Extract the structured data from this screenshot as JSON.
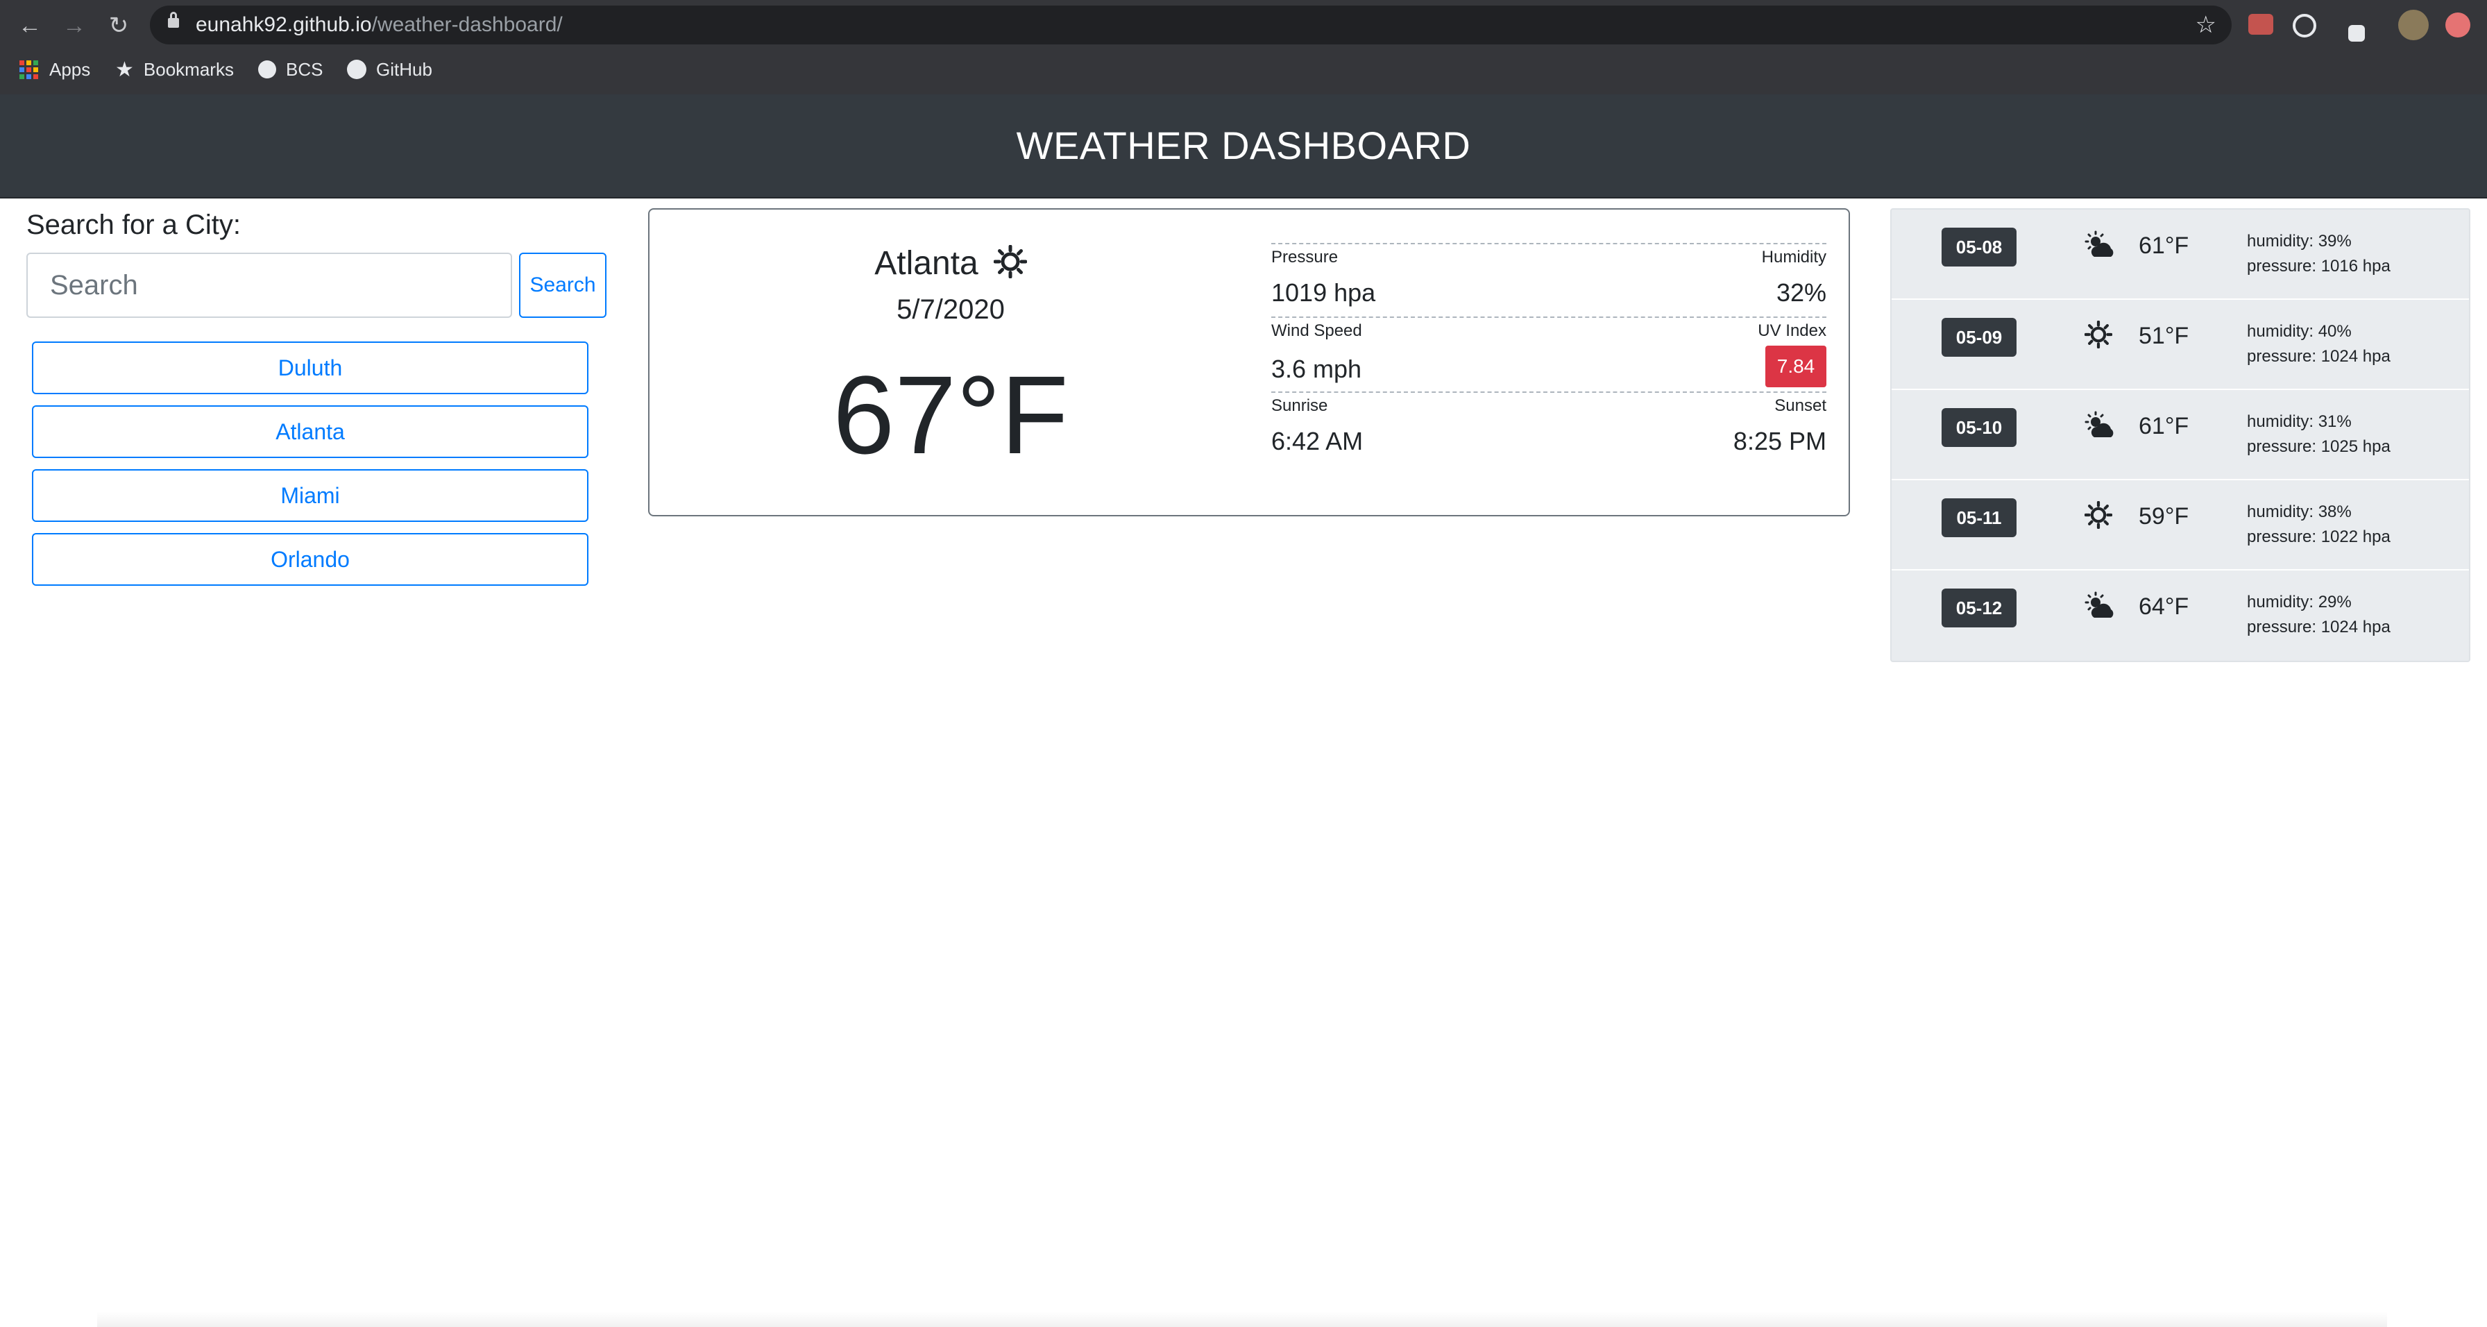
{
  "browser": {
    "url_host": "eunahk92.github.io",
    "url_path": "/weather-dashboard/",
    "bookmarks": [
      {
        "label": "Apps"
      },
      {
        "label": "Bookmarks"
      },
      {
        "label": "BCS"
      },
      {
        "label": "GitHub"
      }
    ]
  },
  "header": {
    "title": "WEATHER DASHBOARD"
  },
  "search": {
    "label": "Search for a City:",
    "placeholder": "Search",
    "button_label": "Search"
  },
  "cities": [
    "Duluth",
    "Atlanta",
    "Miami",
    "Orlando"
  ],
  "current": {
    "city": "Atlanta",
    "icon": "sun-icon",
    "date": "5/7/2020",
    "temp": "67°F",
    "pressure_label": "Pressure",
    "pressure": "1019 hpa",
    "humidity_label": "Humidity",
    "humidity": "32%",
    "wind_label": "Wind Speed",
    "wind": "3.6 mph",
    "uv_label": "UV Index",
    "uv": "7.84",
    "uv_color": "#dc3545",
    "sunrise_label": "Sunrise",
    "sunrise": "6:42 AM",
    "sunset_label": "Sunset",
    "sunset": "8:25 PM"
  },
  "forecast": [
    {
      "date": "05-08",
      "icon": "partly-cloudy-icon",
      "temp": "61°F",
      "humidity": "humidity: 39%",
      "pressure": "pressure: 1016 hpa"
    },
    {
      "date": "05-09",
      "icon": "sun-icon",
      "temp": "51°F",
      "humidity": "humidity: 40%",
      "pressure": "pressure: 1024 hpa"
    },
    {
      "date": "05-10",
      "icon": "partly-cloudy-icon",
      "temp": "61°F",
      "humidity": "humidity: 31%",
      "pressure": "pressure: 1025 hpa"
    },
    {
      "date": "05-11",
      "icon": "sun-icon",
      "temp": "59°F",
      "humidity": "humidity: 38%",
      "pressure": "pressure: 1022 hpa"
    },
    {
      "date": "05-12",
      "icon": "partly-cloudy-icon",
      "temp": "64°F",
      "humidity": "humidity: 29%",
      "pressure": "pressure: 1024 hpa"
    }
  ],
  "colors": {
    "header_bg": "#343a40",
    "primary": "#007bff",
    "danger": "#dc3545",
    "forecast_bg": "#e9ecef"
  }
}
